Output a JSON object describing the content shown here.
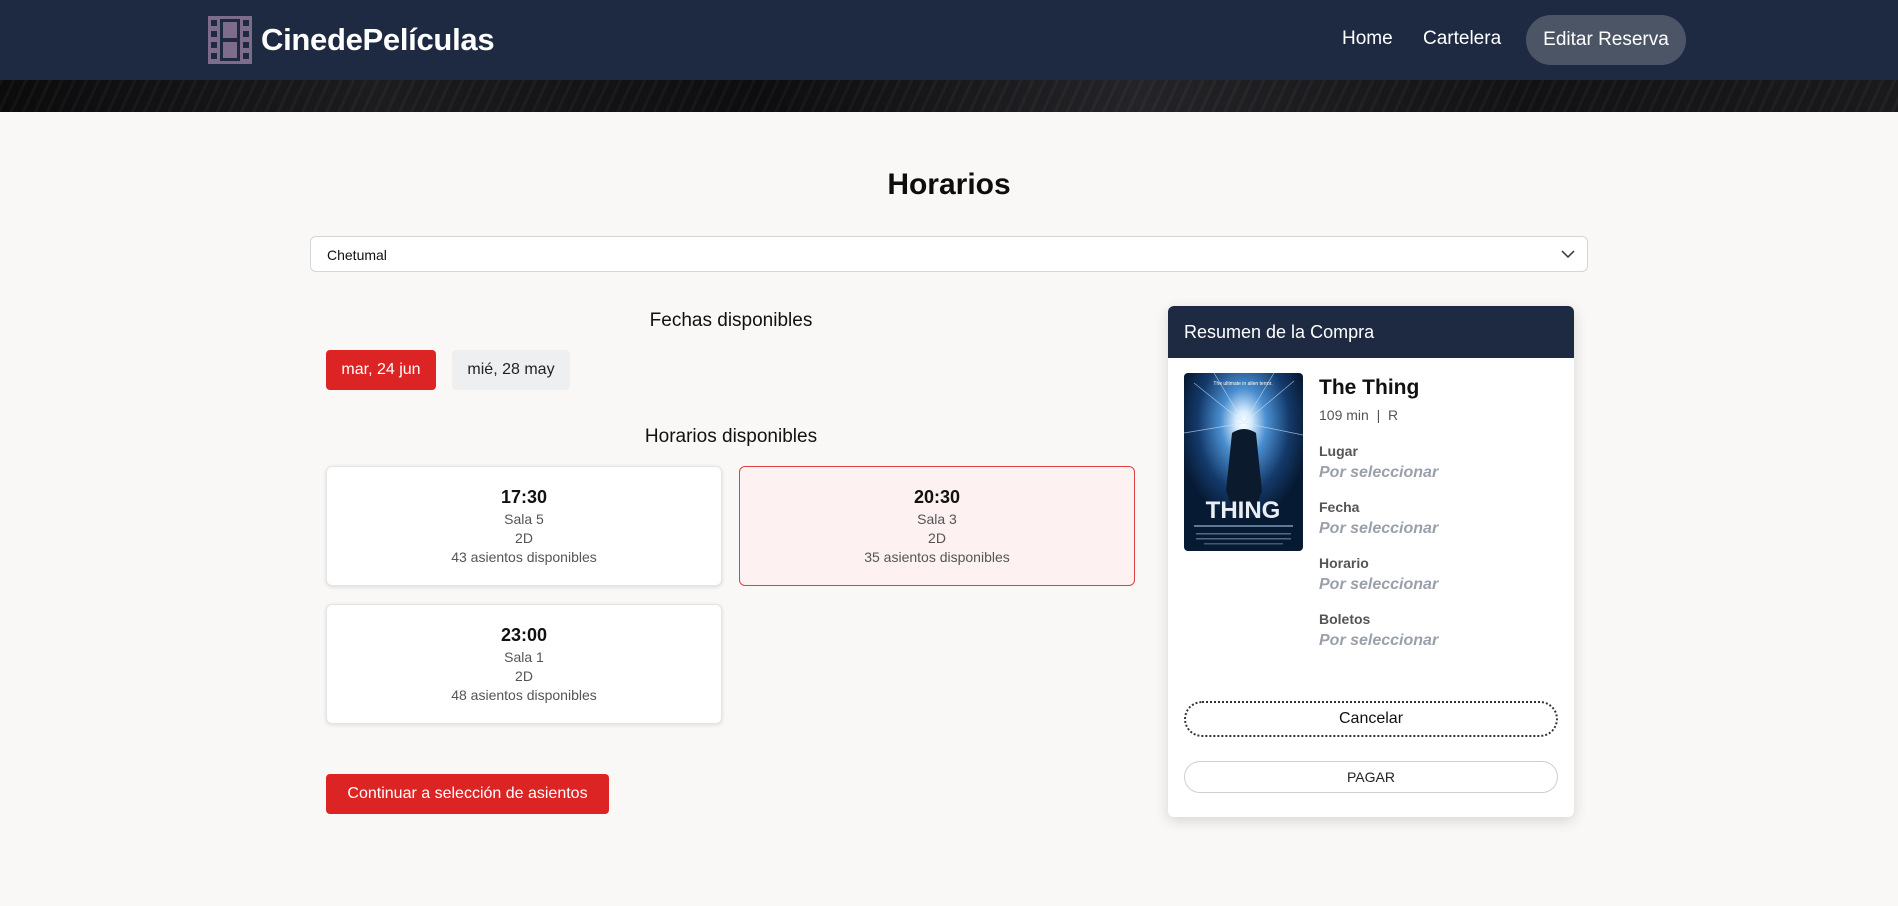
{
  "nav": {
    "brand": "CinedePelículas",
    "links": [
      "Home",
      "Cartelera"
    ],
    "edit_button": "Editar Reserva"
  },
  "page": {
    "title": "Horarios"
  },
  "location_select": {
    "value": "Chetumal"
  },
  "dates": {
    "heading": "Fechas disponibles",
    "items": [
      {
        "label": "mar, 24 jun",
        "selected": true
      },
      {
        "label": "mié, 28 may",
        "selected": false
      }
    ]
  },
  "showtimes": {
    "heading": "Horarios disponibles",
    "items": [
      {
        "time": "17:30",
        "room": "Sala 5",
        "format": "2D",
        "seats": "43 asientos disponibles",
        "selected": false
      },
      {
        "time": "20:30",
        "room": "Sala 3",
        "format": "2D",
        "seats": "35 asientos disponibles",
        "selected": true
      },
      {
        "time": "23:00",
        "room": "Sala 1",
        "format": "2D",
        "seats": "48 asientos disponibles",
        "selected": false
      }
    ]
  },
  "continue_button": "Continuar a selección de asientos",
  "summary": {
    "heading": "Resumen de la Compra",
    "movie": {
      "title": "The Thing",
      "meta": "109 min  |  R",
      "poster_tagline": "The ultimate in alien terror.",
      "poster_title": "THING"
    },
    "fields": [
      {
        "label": "Lugar",
        "value": "Por seleccionar"
      },
      {
        "label": "Fecha",
        "value": "Por seleccionar"
      },
      {
        "label": "Horario",
        "value": "Por seleccionar"
      },
      {
        "label": "Boletos",
        "value": "Por seleccionar"
      }
    ],
    "cancel_button": "Cancelar",
    "pay_button": "PAGAR"
  },
  "colors": {
    "navy": "#1e2a42",
    "accent_red": "#dc2424",
    "page_bg": "#faf8f6"
  }
}
